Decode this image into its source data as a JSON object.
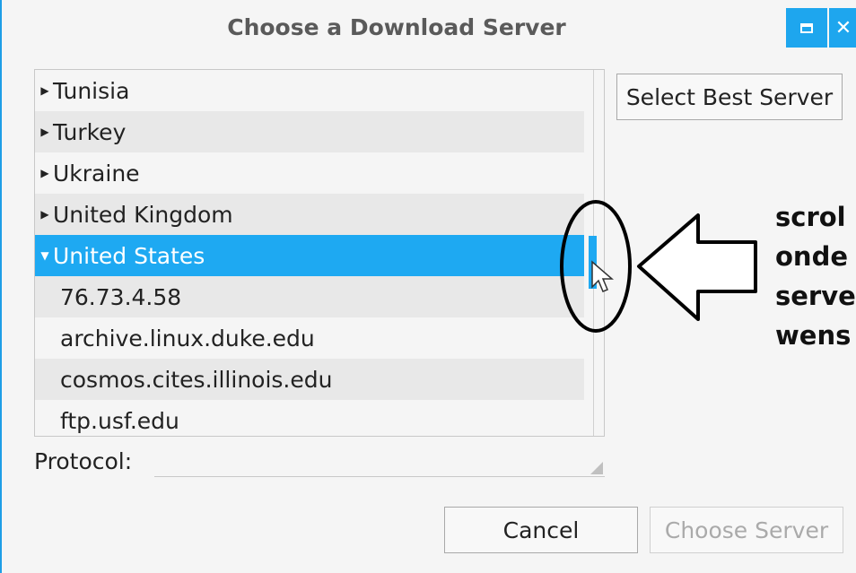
{
  "window": {
    "title": "Choose a Download Server",
    "close_glyph": "✕"
  },
  "server_tree": {
    "rows": [
      {
        "label": "Tunisia",
        "type": "country",
        "expanded": false
      },
      {
        "label": "Turkey",
        "type": "country",
        "expanded": false
      },
      {
        "label": "Ukraine",
        "type": "country",
        "expanded": false
      },
      {
        "label": "United Kingdom",
        "type": "country",
        "expanded": false
      },
      {
        "label": "United States",
        "type": "country",
        "expanded": true,
        "selected": true
      },
      {
        "label": "76.73.4.58",
        "type": "server"
      },
      {
        "label": "archive.linux.duke.edu",
        "type": "server"
      },
      {
        "label": "cosmos.cites.illinois.edu",
        "type": "server"
      },
      {
        "label": "ftp.usf.edu",
        "type": "server"
      }
    ]
  },
  "buttons": {
    "select_best": "Select Best Server",
    "cancel": "Cancel",
    "choose": "Choose Server"
  },
  "protocol": {
    "label": "Protocol:",
    "value": ""
  },
  "annotation": {
    "lines": [
      "scrol",
      "onde",
      "serve",
      "wens"
    ]
  },
  "colors": {
    "accent": "#1ea9f2",
    "title_text": "#5a5a5a"
  }
}
